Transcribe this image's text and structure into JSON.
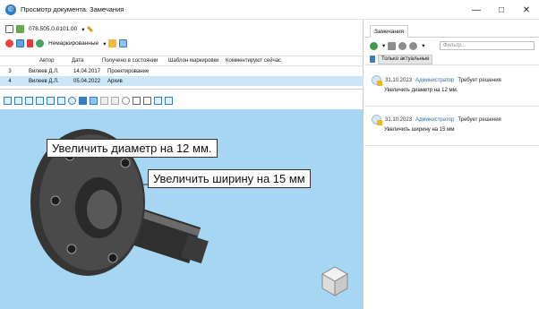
{
  "window": {
    "title": "Просмотр документа. Замечания",
    "minimize": "—",
    "maximize": "□",
    "close": "✕"
  },
  "toolbar1": {
    "doc_number": "078.505.0.0101.00"
  },
  "toolbar2": {
    "marking_filter": "Немаркированные"
  },
  "grid": {
    "columns": [
      "Автор",
      "Дата",
      "Получено в состоянии",
      "Шаблон маркировки",
      "Комментируют сейчас"
    ],
    "rows": [
      {
        "num": "3",
        "author": "Вилеев Д.Л.",
        "date": "14.04.2017",
        "state": "Проектирование"
      },
      {
        "num": "4",
        "author": "Вилеев Д.Л.",
        "date": "05.04.2022",
        "state": "Архив"
      }
    ]
  },
  "viewport": {
    "callouts": [
      {
        "text": "Увеличить диаметр на 12 мм."
      },
      {
        "text": "Увеличить ширину на 15 мм"
      }
    ]
  },
  "remarks": {
    "tab_label": "Замечания",
    "filter_placeholder": "Фильтр...",
    "only_actual_label": "Только актуальные",
    "items": [
      {
        "date": "31.10.2023",
        "author": "Администратор",
        "status": "Требует решения",
        "text": "Увеличить диаметр на 12 мм."
      },
      {
        "date": "31.10.2023",
        "author": "Администратор",
        "status": "Требует решения",
        "text": "Увеличить ширину на 15 мм"
      }
    ]
  },
  "colors": {
    "viewport_bg": "#a7d6f3",
    "selection": "#cce5f7",
    "link": "#2f6fb0"
  }
}
